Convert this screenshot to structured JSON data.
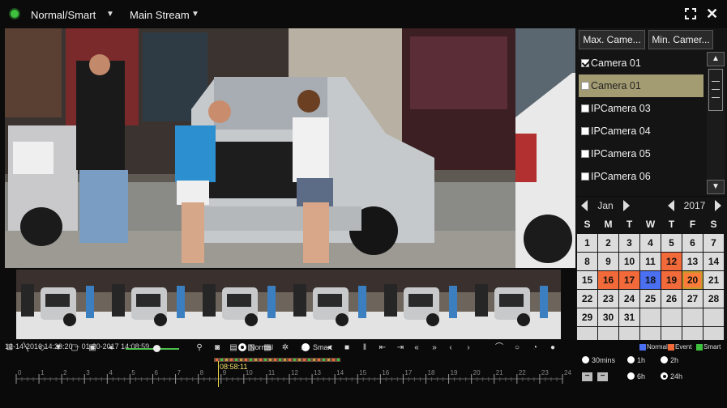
{
  "header": {
    "mode_label": "Normal/Smart",
    "stream_label": "Main Stream"
  },
  "camera_panel": {
    "max_button": "Max. Came...",
    "min_button": "Min. Camer...",
    "items": [
      {
        "label": "Camera 01",
        "checked": true,
        "selected": false
      },
      {
        "label": "Camera 01",
        "checked": false,
        "selected": true
      },
      {
        "label": "IPCamera 03",
        "checked": false,
        "selected": false
      },
      {
        "label": "IPCamera 04",
        "checked": false,
        "selected": false
      },
      {
        "label": "IPCamera 05",
        "checked": false,
        "selected": false
      },
      {
        "label": "IPCamera 06",
        "checked": false,
        "selected": false
      }
    ]
  },
  "calendar": {
    "month": "Jan",
    "year": "2017",
    "weekdays": [
      "S",
      "M",
      "T",
      "W",
      "T",
      "F",
      "S"
    ],
    "weeks": [
      [
        "1",
        "2",
        "3",
        "4",
        "5",
        "6",
        "7"
      ],
      [
        "8",
        "9",
        "10",
        "11",
        "12",
        "13",
        "14"
      ],
      [
        "15",
        "16",
        "17",
        "18",
        "19",
        "20",
        "21"
      ],
      [
        "22",
        "23",
        "24",
        "25",
        "26",
        "27",
        "28"
      ],
      [
        "29",
        "30",
        "31",
        "",
        "",
        "",
        ""
      ],
      [
        "",
        "",
        "",
        "",
        "",
        "",
        ""
      ]
    ],
    "event_days": [
      "12",
      "16",
      "17",
      "19"
    ],
    "normal_days": [
      "18"
    ],
    "selected_day": "20"
  },
  "timeline": {
    "range_text": "12-14-2016 14:29:20 -- 01-20-2017 14:08:59",
    "filter_normal": "Normal",
    "filter_smart": "Smart",
    "cursor_time": "08:58:11",
    "hour_ticks": [
      "0",
      "1",
      "2",
      "3",
      "4",
      "5",
      "6",
      "7",
      "8",
      "9",
      "10",
      "11",
      "12",
      "13",
      "14",
      "15",
      "16",
      "17",
      "18",
      "19",
      "20",
      "21",
      "22",
      "23",
      "24"
    ],
    "volume_level": 0.5
  },
  "legend": {
    "normal": "Normal",
    "event": "Event",
    "smart": "Smart",
    "normal_color": "#4a6ff0",
    "event_color": "#f26a3a",
    "smart_color": "#3ec13e"
  },
  "time_span": {
    "options": [
      "30mins",
      "1h",
      "2h",
      "6h",
      "24h"
    ],
    "selected": "24h"
  }
}
